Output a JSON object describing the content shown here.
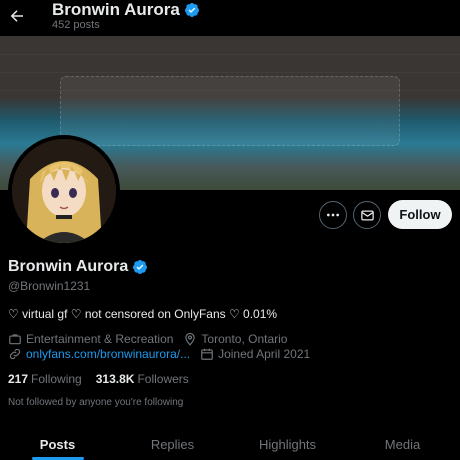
{
  "header": {
    "name": "Bronwin Aurora",
    "post_count": "452 posts"
  },
  "banner": {
    "description": ""
  },
  "profile": {
    "name": "Bronwin Aurora",
    "handle": "@Bronwin1231",
    "verified": true,
    "bio": "♡ virtual gf ♡ not censored on OnlyFans ♡ 0.01%",
    "category": "Entertainment & Recreation",
    "location": "Toronto, Ontario",
    "website": "onlyfans.com/bronwinaurora/...",
    "joined": "Joined April 2021"
  },
  "actions": {
    "follow_label": "Follow"
  },
  "stats": {
    "following_count": "217",
    "following_label": "Following",
    "followers_count": "313.8K",
    "followers_label": "Followers"
  },
  "followed_note": "Not followed by anyone you're following",
  "tabs": [
    {
      "label": "Posts",
      "active": true
    },
    {
      "label": "Replies",
      "active": false
    },
    {
      "label": "Highlights",
      "active": false
    },
    {
      "label": "Media",
      "active": false
    }
  ],
  "colors": {
    "background": "#000000",
    "text_primary": "#e7e9ea",
    "text_secondary": "#71767b",
    "accent": "#1d9bf0",
    "follow_button": "#eff3f4"
  },
  "icons": [
    "back-arrow-icon",
    "verified-badge-icon",
    "more-icon",
    "message-icon",
    "briefcase-icon",
    "location-pin-icon",
    "link-icon",
    "calendar-icon"
  ]
}
